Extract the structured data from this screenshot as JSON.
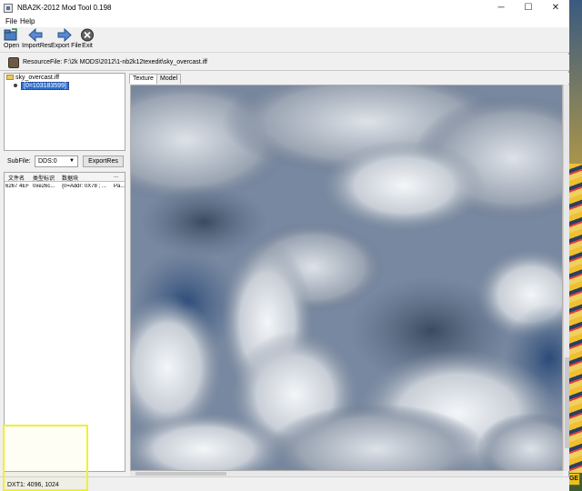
{
  "window": {
    "title": "NBA2K-2012 Mod Tool 0.198",
    "minimize": "─",
    "maximize": "☐",
    "close": "✕"
  },
  "menu": [
    "File",
    "Help"
  ],
  "toolbar": {
    "open": "Open",
    "import": "ImportRes",
    "export_file": "Export File",
    "exit": "Exit"
  },
  "resource": {
    "label": "ResourceFile:  F:\\2k MODS\\2012\\1-nb2k12texedit\\sky_overcast.iff"
  },
  "tree": {
    "root": "sky_overcast.iff",
    "child": "[0=103183599]"
  },
  "subfile": {
    "label": "SubFile:",
    "value": "DDS:0",
    "export_button": "ExportRes"
  },
  "table": {
    "headers": [
      "文件名",
      "类型标识",
      "数据块",
      "..."
    ],
    "rows": [
      [
        "6267 4EF",
        "0xe26c...",
        "{0=Addr: 0X78 ; ...",
        "Pa..."
      ]
    ]
  },
  "tabs": [
    "Texture",
    "Model"
  ],
  "status": "DXT1: 4096, 1024",
  "colors": {
    "accent": "#3070d0",
    "highlight_box": "#f0f030"
  }
}
